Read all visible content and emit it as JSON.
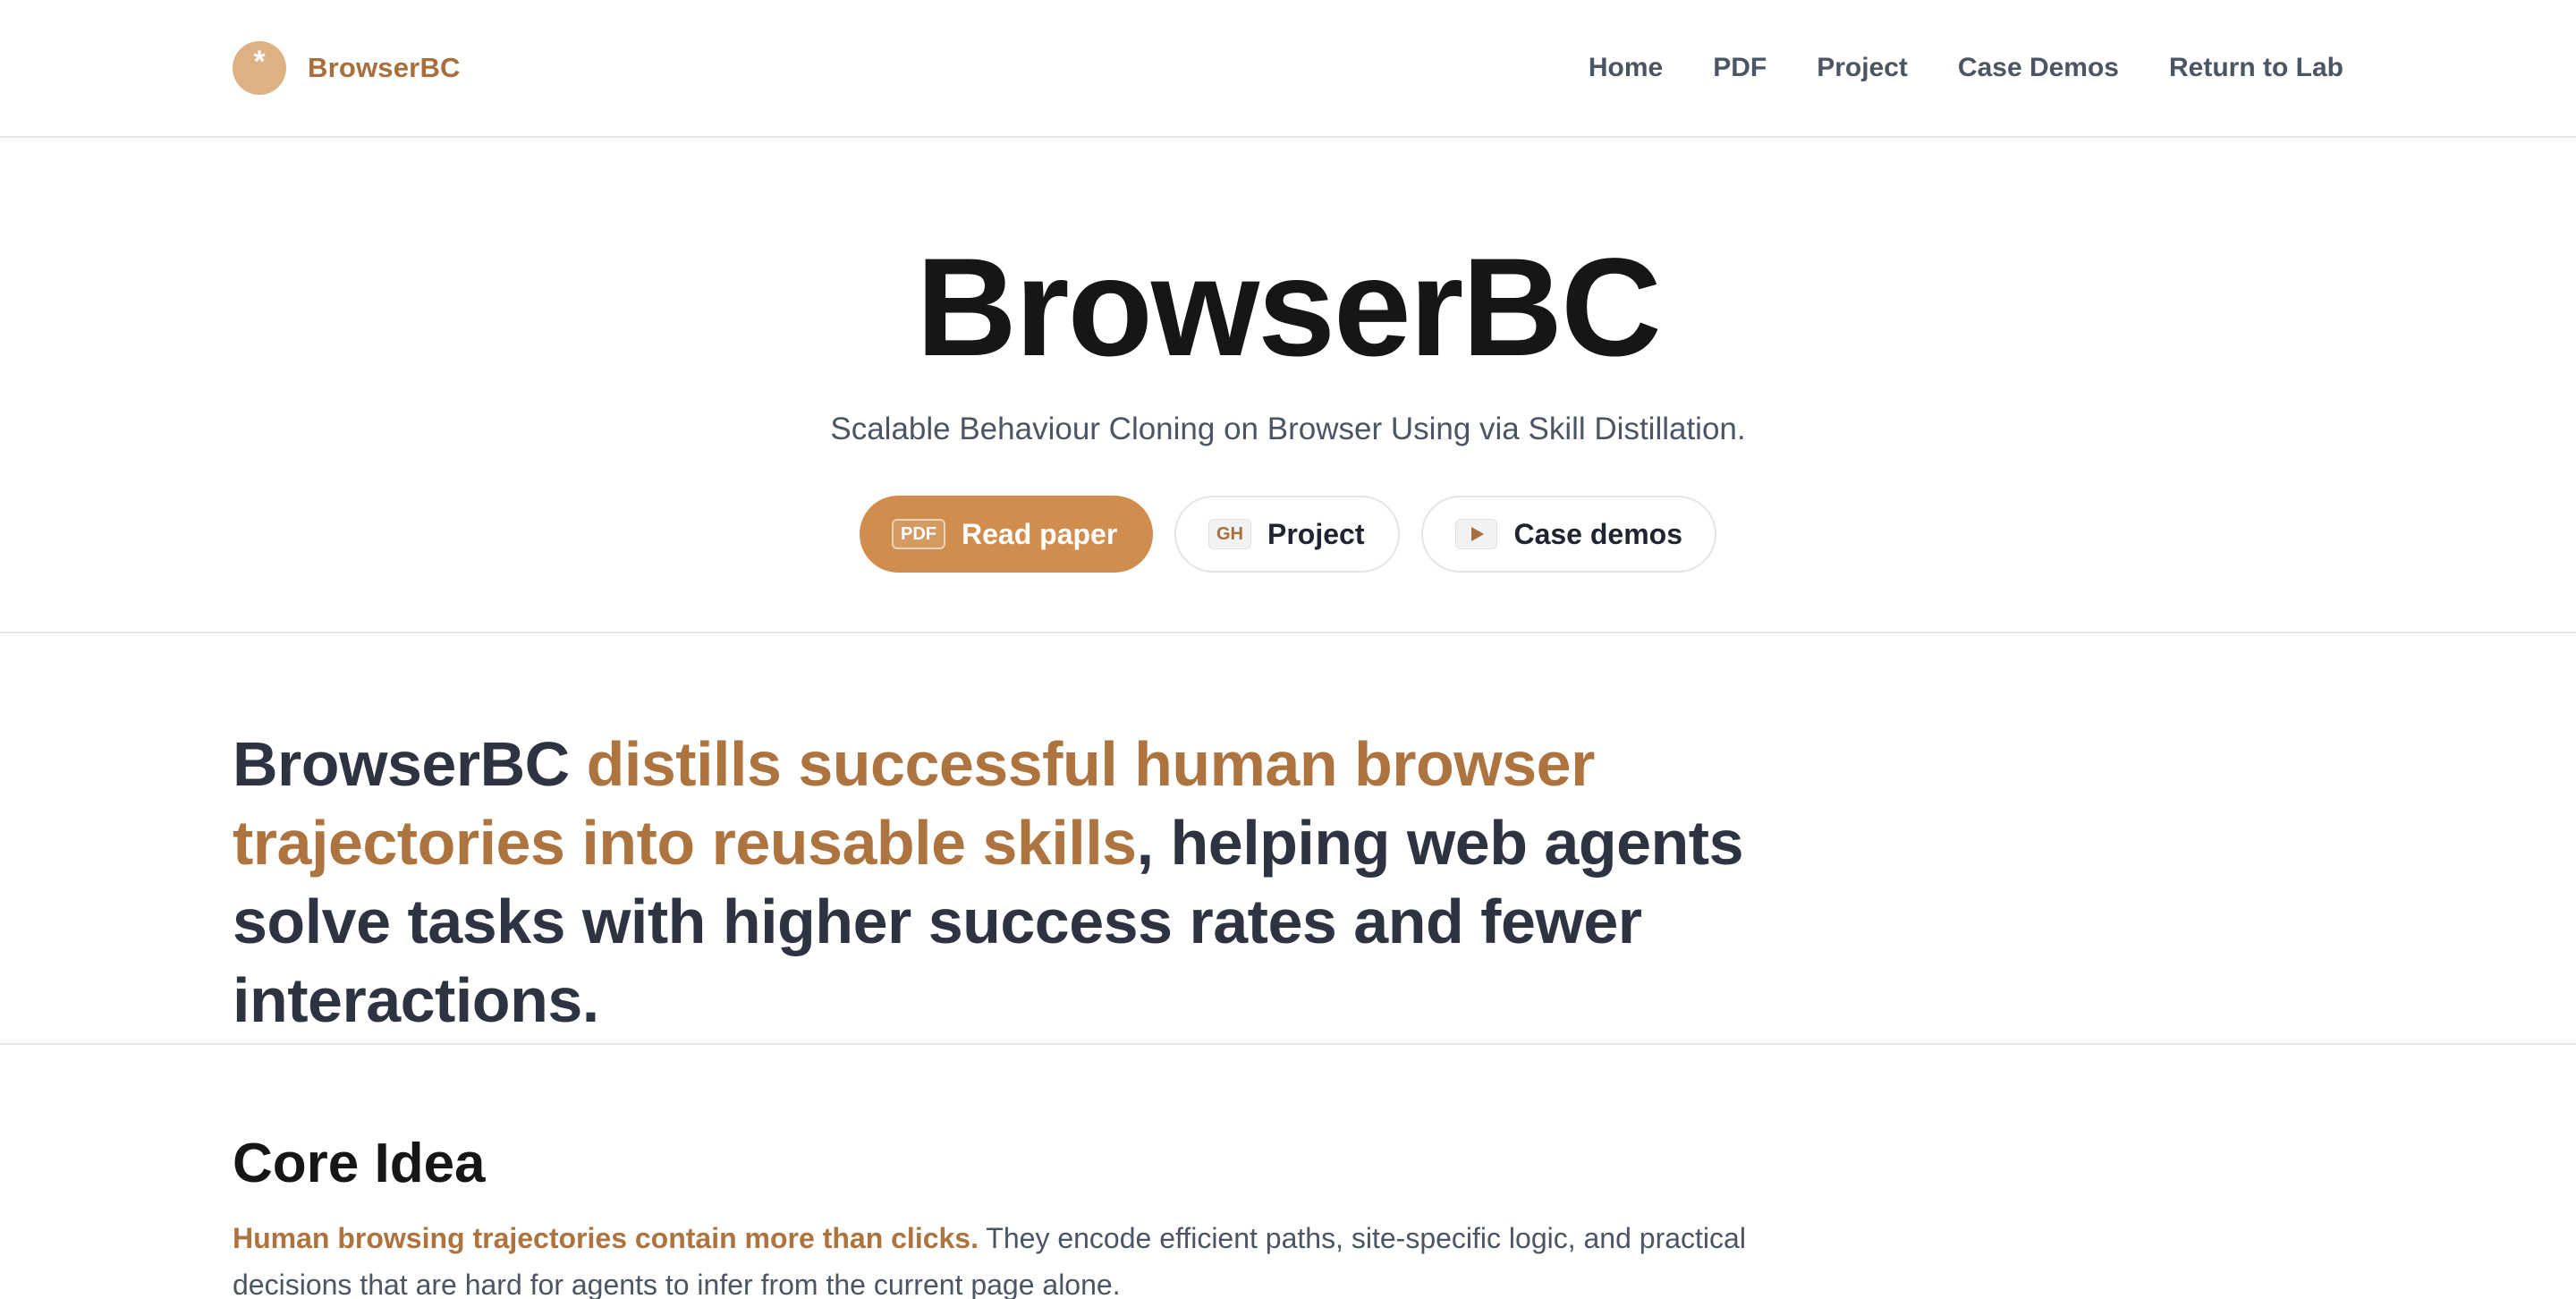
{
  "brand": {
    "logo_glyph": "*",
    "name": "BrowserBC",
    "logo_color": "#deb185",
    "accent_color": "#a86e3c"
  },
  "nav": {
    "items": [
      {
        "label": "Home"
      },
      {
        "label": "PDF"
      },
      {
        "label": "Project"
      },
      {
        "label": "Case Demos"
      },
      {
        "label": "Return to Lab"
      }
    ]
  },
  "hero": {
    "title": "BrowserBC",
    "subtitle": "Scalable Behaviour Cloning on Browser Using via Skill Distillation.",
    "buttons": {
      "read_paper": {
        "chip": "PDF",
        "label": "Read paper",
        "bg_color": "#d08d4d"
      },
      "project": {
        "chip": "GH",
        "label": "Project"
      },
      "case_demos": {
        "icon": "play-icon",
        "label": "Case demos"
      }
    }
  },
  "statement": {
    "part1": "BrowserBC ",
    "accent": "distills successful human browser trajectories into reusable skills",
    "part2": ", helping web agents solve tasks with higher success rates and fewer interactions."
  },
  "core_idea": {
    "title": "Core Idea",
    "lead": "Human browsing trajectories contain more than clicks.",
    "body": " They encode efficient paths, site-specific logic, and practical decisions that are hard for agents to infer from the current page alone."
  }
}
